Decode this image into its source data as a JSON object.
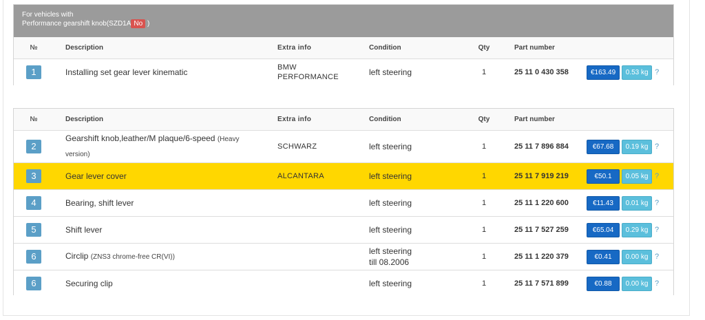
{
  "banner": {
    "line1": "For vehicles with",
    "line2": "Performance gearshift knob(SZD1A",
    "badge": "No",
    "line2_end": ")"
  },
  "columns": {
    "no": "№",
    "description": "Description",
    "extra": "Extra info",
    "condition": "Condition",
    "qty": "Qty",
    "part": "Part number"
  },
  "table1": {
    "rows": [
      {
        "no": "1",
        "description": "Installing set gear lever kinematic",
        "note": "",
        "extra_line1": "BMW",
        "extra_line2": "PERFORMANCE",
        "condition_line1": "left steering",
        "condition_line2": "",
        "qty": "1",
        "part": "25 11 0 430 358",
        "price": "€163.49",
        "weight": "0.53 kg",
        "help": "?"
      }
    ]
  },
  "table2": {
    "rows": [
      {
        "no": "2",
        "description": "Gearshift knob,leather/M plaque/6-speed",
        "note": "(Heavy version)",
        "extra_line1": "SCHWARZ",
        "extra_line2": "",
        "condition_line1": "left steering",
        "condition_line2": "",
        "qty": "1",
        "part": "25 11 7 896 884",
        "price": "€67.68",
        "weight": "0.19 kg",
        "help": "?"
      },
      {
        "no": "3",
        "description": "Gear lever cover",
        "note": "",
        "extra_line1": "ALCANTARA",
        "extra_line2": "",
        "condition_line1": "left steering",
        "condition_line2": "",
        "qty": "1",
        "part": "25 11 7 919 219",
        "price": "€50.1",
        "weight": "0.05 kg",
        "help": "?"
      },
      {
        "no": "4",
        "description": "Bearing, shift lever",
        "note": "",
        "extra_line1": "",
        "extra_line2": "",
        "condition_line1": "left steering",
        "condition_line2": "",
        "qty": "1",
        "part": "25 11 1 220 600",
        "price": "€11.43",
        "weight": "0.01 kg",
        "help": "?"
      },
      {
        "no": "5",
        "description": "Shift lever",
        "note": "",
        "extra_line1": "",
        "extra_line2": "",
        "condition_line1": "left steering",
        "condition_line2": "",
        "qty": "1",
        "part": "25 11 7 527 259",
        "price": "€65.04",
        "weight": "0.29 kg",
        "help": "?"
      },
      {
        "no": "6",
        "description": "Circlip",
        "note": "(ZNS3 chrome-free CR(VI))",
        "extra_line1": "",
        "extra_line2": "",
        "condition_line1": "left steering",
        "condition_line2": "till 08.2006",
        "qty": "1",
        "part": "25 11 1 220 379",
        "price": "€0.41",
        "weight": "0.00 kg",
        "help": "?"
      },
      {
        "no": "6",
        "description": "Securing clip",
        "note": "",
        "extra_line1": "",
        "extra_line2": "",
        "condition_line1": "left steering",
        "condition_line2": "",
        "qty": "1",
        "part": "25 11 7 571 899",
        "price": "€0.88",
        "weight": "0.00 kg",
        "help": "?"
      }
    ]
  },
  "colors": {
    "banner_bg": "#9b9b9b",
    "highlight_row": "#ffd700",
    "price_button": "#1769c4",
    "weight_button": "#5bbfdc",
    "number_badge": "#5b9fc7",
    "no_badge": "#d9534f"
  }
}
